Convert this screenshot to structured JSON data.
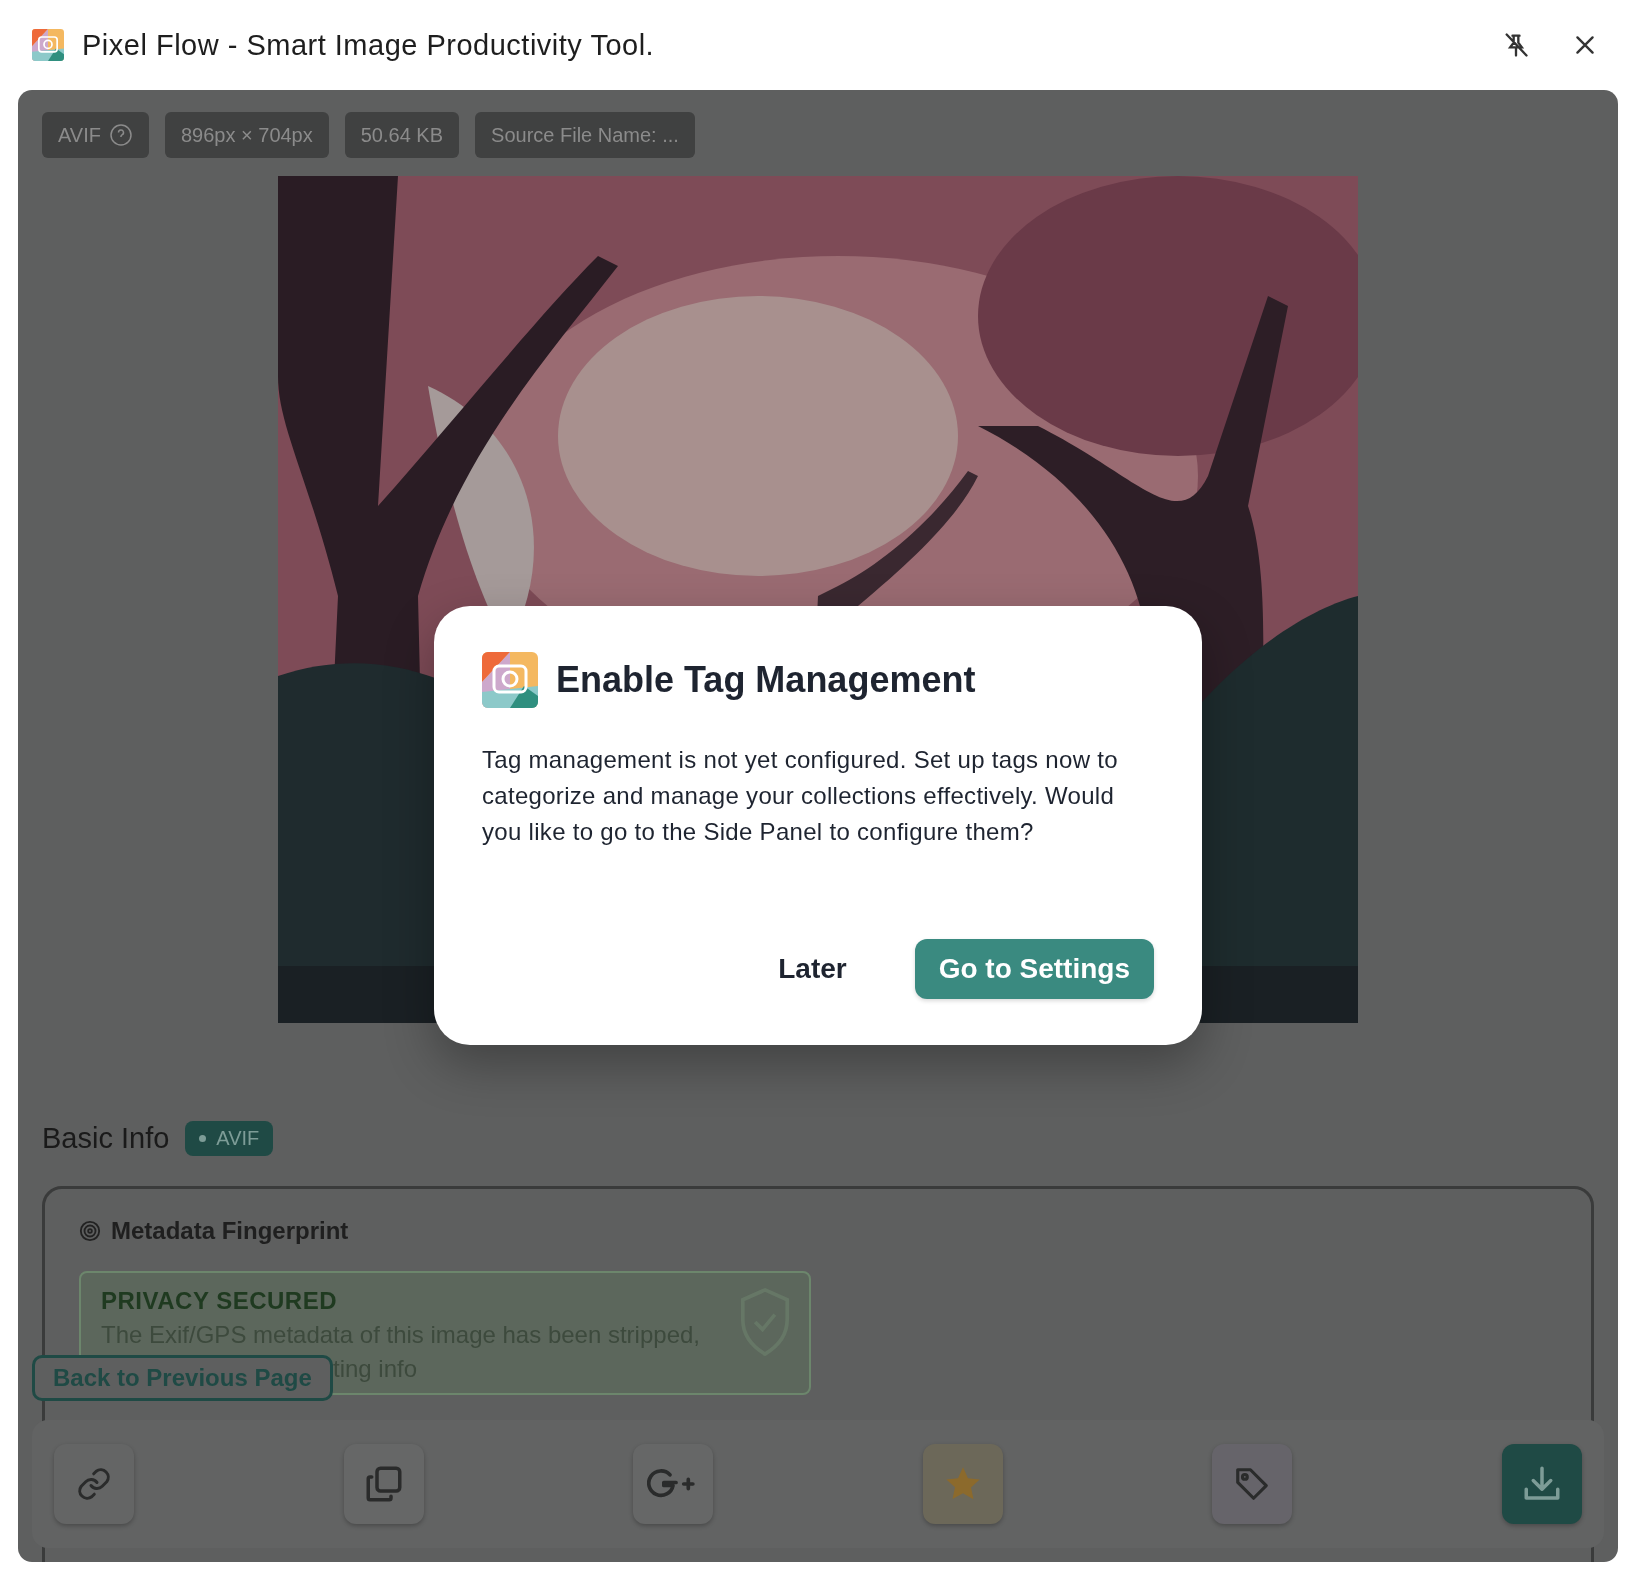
{
  "window": {
    "title": "Pixel Flow - Smart Image Productivity Tool."
  },
  "chips": [
    {
      "text": "AVIF",
      "help": true
    },
    {
      "text": "896px × 704px",
      "help": false
    },
    {
      "text": "50.64 KB",
      "help": false
    },
    {
      "text": "Source File Name: ...",
      "help": false
    }
  ],
  "dialog": {
    "title": "Enable Tag Management",
    "message": "Tag management is not yet configured. Set up tags now to categorize and manage your collections effectively. Would you like to go to the Side Panel to configure them?",
    "buttons": [
      {
        "label": "Later",
        "kind": "secondary"
      },
      {
        "label": "Go to Settings",
        "kind": "primary"
      }
    ]
  },
  "basic_info": {
    "heading": "Basic Info",
    "badge": "AVIF"
  },
  "metadata": {
    "heading": "Metadata Fingerprint",
    "privacy": {
      "heading": "PRIVACY SECURED",
      "lines": [
        "The Exif/GPS metadata of this image has been stripped,",
        "ting info"
      ]
    }
  },
  "back_button": {
    "label": "Back to Previous Page"
  },
  "toolbar": [
    {
      "kind": "link"
    },
    {
      "kind": "copy"
    },
    {
      "kind": "google"
    },
    {
      "kind": "star"
    },
    {
      "kind": "tag"
    },
    {
      "kind": "download"
    }
  ]
}
